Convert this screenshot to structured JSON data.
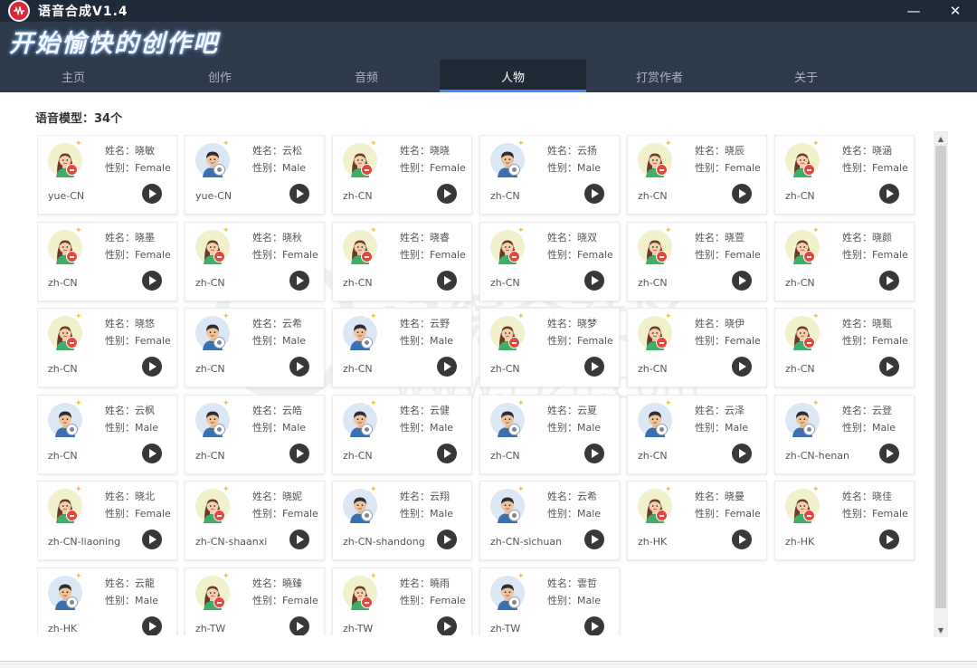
{
  "app": {
    "title": "语音合成V1.4",
    "slogan": "开始愉快的创作吧"
  },
  "window": {
    "minimize": "—",
    "close": "✕"
  },
  "tabs": [
    {
      "label": "主页",
      "active": false
    },
    {
      "label": "创作",
      "active": false
    },
    {
      "label": "音频",
      "active": false
    },
    {
      "label": "人物",
      "active": true
    },
    {
      "label": "打赏作者",
      "active": false
    },
    {
      "label": "关于",
      "active": false
    }
  ],
  "content": {
    "model_count": "语音模型：34个"
  },
  "watermark": {
    "text": "i3综合社区",
    "url": "www.i3zh.com"
  },
  "voices": [
    {
      "name": "姓名：晓敏",
      "gender": "性别：Female",
      "lang": "yue-CN",
      "type": "female"
    },
    {
      "name": "姓名：云松",
      "gender": "性别：Male",
      "lang": "yue-CN",
      "type": "male"
    },
    {
      "name": "姓名：晓晓",
      "gender": "性别：Female",
      "lang": "zh-CN",
      "type": "female"
    },
    {
      "name": "姓名：云扬",
      "gender": "性别：Male",
      "lang": "zh-CN",
      "type": "male"
    },
    {
      "name": "姓名：晓辰",
      "gender": "性别：Female",
      "lang": "zh-CN",
      "type": "female"
    },
    {
      "name": "姓名：晓涵",
      "gender": "性别：Female",
      "lang": "zh-CN",
      "type": "female"
    },
    {
      "name": "姓名：晓墨",
      "gender": "性别：Female",
      "lang": "zh-CN",
      "type": "female"
    },
    {
      "name": "姓名：晓秋",
      "gender": "性别：Female",
      "lang": "zh-CN",
      "type": "female"
    },
    {
      "name": "姓名：晓睿",
      "gender": "性别：Female",
      "lang": "zh-CN",
      "type": "female"
    },
    {
      "name": "姓名：晓双",
      "gender": "性别：Female",
      "lang": "zh-CN",
      "type": "female"
    },
    {
      "name": "姓名：晓萱",
      "gender": "性别：Female",
      "lang": "zh-CN",
      "type": "female"
    },
    {
      "name": "姓名：晓颜",
      "gender": "性别：Female",
      "lang": "zh-CN",
      "type": "female"
    },
    {
      "name": "姓名：晓悠",
      "gender": "性别：Female",
      "lang": "zh-CN",
      "type": "female"
    },
    {
      "name": "姓名：云希",
      "gender": "性别：Male",
      "lang": "zh-CN",
      "type": "male"
    },
    {
      "name": "姓名：云野",
      "gender": "性别：Male",
      "lang": "zh-CN",
      "type": "male"
    },
    {
      "name": "姓名：晓梦",
      "gender": "性别：Female",
      "lang": "zh-CN",
      "type": "female"
    },
    {
      "name": "姓名：晓伊",
      "gender": "性别：Female",
      "lang": "zh-CN",
      "type": "female"
    },
    {
      "name": "姓名：晓甄",
      "gender": "性别：Female",
      "lang": "zh-CN",
      "type": "female"
    },
    {
      "name": "姓名：云枫",
      "gender": "性别：Male",
      "lang": "zh-CN",
      "type": "male"
    },
    {
      "name": "姓名：云皓",
      "gender": "性别：Male",
      "lang": "zh-CN",
      "type": "male"
    },
    {
      "name": "姓名：云健",
      "gender": "性别：Male",
      "lang": "zh-CN",
      "type": "male"
    },
    {
      "name": "姓名：云夏",
      "gender": "性别：Male",
      "lang": "zh-CN",
      "type": "male"
    },
    {
      "name": "姓名：云泽",
      "gender": "性别：Male",
      "lang": "zh-CN",
      "type": "male"
    },
    {
      "name": "姓名：云登",
      "gender": "性别：Male",
      "lang": "zh-CN-henan",
      "type": "male"
    },
    {
      "name": "姓名：晓北",
      "gender": "性别：Female",
      "lang": "zh-CN-liaoning",
      "type": "female"
    },
    {
      "name": "姓名：晓妮",
      "gender": "性别：Female",
      "lang": "zh-CN-shaanxi",
      "type": "female"
    },
    {
      "name": "姓名：云翔",
      "gender": "性别：Male",
      "lang": "zh-CN-shandong",
      "type": "male"
    },
    {
      "name": "姓名：云希",
      "gender": "性别：Male",
      "lang": "zh-CN-sichuan",
      "type": "male"
    },
    {
      "name": "姓名：晓曼",
      "gender": "性别：Female",
      "lang": "zh-HK",
      "type": "female"
    },
    {
      "name": "姓名：晓佳",
      "gender": "性别：Female",
      "lang": "zh-HK",
      "type": "female"
    },
    {
      "name": "姓名：云龍",
      "gender": "性别：Male",
      "lang": "zh-HK",
      "type": "male"
    },
    {
      "name": "姓名：曉臻",
      "gender": "性别：Female",
      "lang": "zh-TW",
      "type": "female"
    },
    {
      "name": "姓名：曉雨",
      "gender": "性别：Female",
      "lang": "zh-TW",
      "type": "female"
    },
    {
      "name": "姓名：雲哲",
      "gender": "性别：Male",
      "lang": "zh-TW",
      "type": "male"
    }
  ],
  "icons": {
    "logo": "microphone-logo-icon",
    "play": "play-icon",
    "female": "female-avatar-icon",
    "male": "male-avatar-icon"
  },
  "colors": {
    "titlebar": "#1f2a38",
    "header": "#2c3a4c",
    "active_tab": "#1f2a37",
    "tab_indicator": "#3d8bf2",
    "play_button": "#383838"
  }
}
